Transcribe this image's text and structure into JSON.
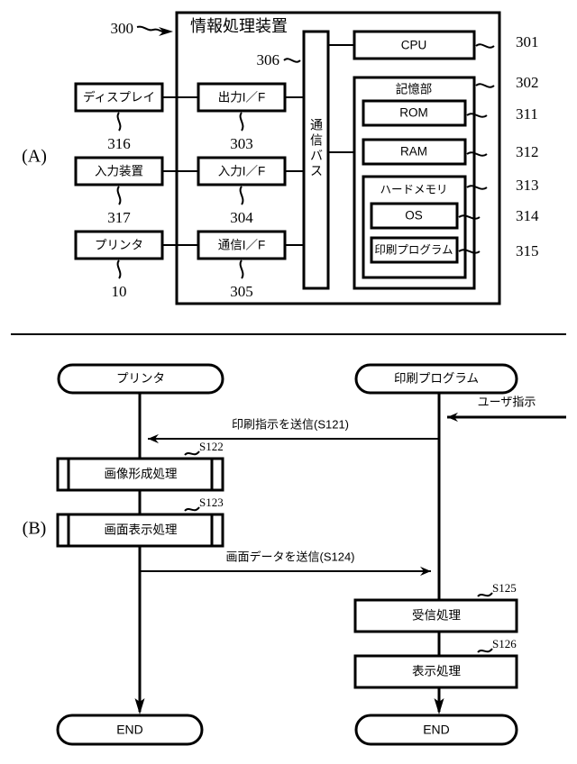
{
  "figure": {
    "panel_a_tag": "(A)",
    "panel_b_tag": "(B)"
  },
  "panel_a": {
    "system_ref": "300",
    "device_title": "情報処理装置",
    "bus": {
      "label": "通信バス",
      "label_chars": [
        "通",
        "信",
        "バ",
        "ス"
      ],
      "ref": "306"
    },
    "peripherals": [
      {
        "label": "ディスプレイ",
        "ref": "316"
      },
      {
        "label": "入力装置",
        "ref": "317"
      },
      {
        "label": "プリンタ",
        "ref": "10"
      }
    ],
    "interfaces": [
      {
        "label": "出力I／F",
        "ref": "303"
      },
      {
        "label": "入力I／F",
        "ref": "304"
      },
      {
        "label": "通信I／F",
        "ref": "305"
      }
    ],
    "cpu": {
      "label": "CPU",
      "ref": "301"
    },
    "storage": {
      "label": "記憶部",
      "ref": "302",
      "items": [
        {
          "label": "ROM",
          "ref": "311"
        },
        {
          "label": "RAM",
          "ref": "312"
        }
      ],
      "hard_memory": {
        "label": "ハードメモリ",
        "ref": "313",
        "items": [
          {
            "label": "OS",
            "ref": "314"
          },
          {
            "label": "印刷プログラム",
            "ref": "315"
          }
        ]
      }
    }
  },
  "panel_b": {
    "lanes": [
      {
        "label": "プリンタ",
        "end_label": "END"
      },
      {
        "label": "印刷プログラム",
        "end_label": "END"
      }
    ],
    "user_instruction": "ユーザ指示",
    "messages": [
      {
        "label": "印刷指示を送信(S121)",
        "direction": "right-to-left"
      },
      {
        "label": "画面データを送信(S124)",
        "direction": "left-to-right"
      }
    ],
    "printer_steps": [
      {
        "label": "画像形成処理",
        "ref": "S122",
        "kind": "predefined-process"
      },
      {
        "label": "画面表示処理",
        "ref": "S123",
        "kind": "predefined-process"
      }
    ],
    "program_steps": [
      {
        "label": "受信処理",
        "ref": "S125",
        "kind": "process"
      },
      {
        "label": "表示処理",
        "ref": "S126",
        "kind": "process"
      }
    ]
  },
  "colors": {
    "line": "#000000",
    "background": "#ffffff"
  }
}
